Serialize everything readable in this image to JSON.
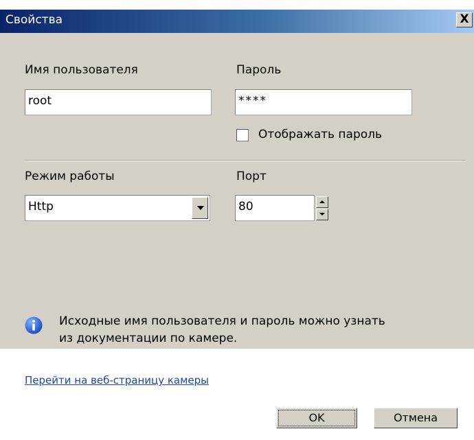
{
  "window": {
    "title": "Свойства",
    "close_label": "X"
  },
  "form": {
    "username_label": "Имя пользователя",
    "username_value": "root",
    "password_label": "Пароль",
    "password_value": "****",
    "show_password_label": "Отображать пароль",
    "mode_label": "Режим работы",
    "mode_value": "Http",
    "port_label": "Порт",
    "port_value": "80"
  },
  "info": {
    "line1": "Исходные имя пользователя и пароль можно узнать",
    "line2": "из документации по камере."
  },
  "footer": {
    "link_text": "Перейти на веб-страницу камеры",
    "ok_label": "OK",
    "cancel_label": "Отмена"
  }
}
